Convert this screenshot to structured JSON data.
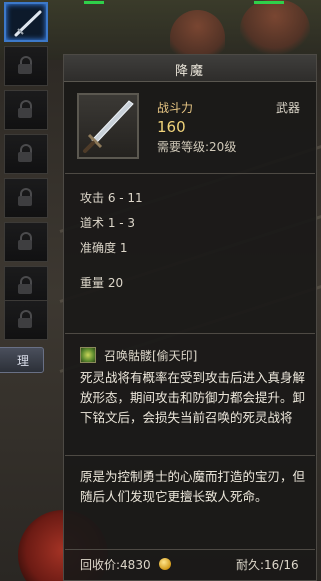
{
  "inventory": {
    "manage_label": "理",
    "selected_item_icon": "sword-icon",
    "locked_slot_icon": "lock-icon"
  },
  "tooltip": {
    "title": "降魔",
    "item_type": "武器",
    "combat_power_label": "战斗力",
    "combat_power_value": "160",
    "level_requirement": "需要等级:20级",
    "stats": {
      "attack": "攻击 6 - 11",
      "taoism": "道术 1 - 3",
      "accuracy": "准确度 1",
      "weight": "重量 20"
    },
    "skill": {
      "name": "召唤骷髅[偷天印]",
      "icon": "skill-rune-icon",
      "description": "死灵战将有概率在受到攻击后进入真身解放形态，期间攻击和防御力都会提升。卸下铭文后，会损失当前召唤的死灵战将"
    },
    "lore": "原是为控制勇士的心魔而打造的宝刃，但随后人们发现它更擅长致人死命。",
    "footer": {
      "sell_price": "回收价:4830",
      "coin_icon": "gold-coin-icon",
      "durability": "耐久:16/16"
    }
  },
  "colors": {
    "tooltip_bg": "#1a1918",
    "title_gold": "#e7c684",
    "selection_blue": "#3d79c9"
  }
}
